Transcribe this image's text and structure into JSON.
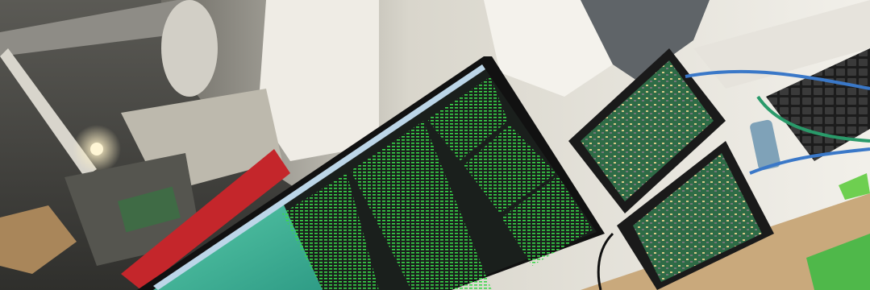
{
  "scene": {
    "description_label": "",
    "colors": {
      "wall": "#e8e6df",
      "ceiling_dark": "#4a4a46",
      "monitor_bezel": "#111111",
      "terminal_bg": "#1a1f1c",
      "terminal_text": "#39d84a",
      "table": "#c9a97c",
      "box_red": "#c4262b",
      "cable_blue": "#3a78c8",
      "pcb_green": "#2e6b46",
      "green_object": "#4fb84a"
    },
    "objects": [
      {
        "name": "monitor-with-terminals",
        "icon": "monitor-icon"
      },
      {
        "name": "single-board-computer-top",
        "icon": "circuit-board-icon"
      },
      {
        "name": "single-board-computer-bottom",
        "icon": "circuit-board-icon"
      },
      {
        "name": "keyboard",
        "icon": "keyboard-icon"
      },
      {
        "name": "soda-can",
        "icon": "can-icon"
      },
      {
        "name": "ceiling-lamp",
        "icon": "lamp-icon"
      },
      {
        "name": "cardboard-boxes",
        "icon": "box-icon"
      }
    ]
  }
}
